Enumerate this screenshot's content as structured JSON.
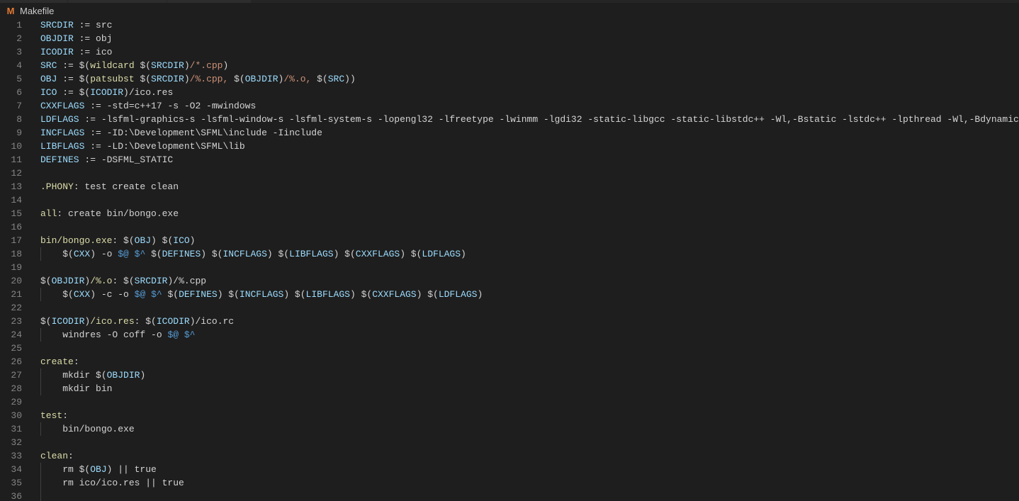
{
  "tab": {
    "icon": "makefile-icon",
    "filename": "Makefile",
    "icon_letter": "M"
  },
  "colors": {
    "background": "#1e1e1e",
    "line_number": "#858585",
    "variable": "#9cdcfe",
    "string": "#ce9178",
    "target": "#dcdcaa",
    "automatic_variable": "#569cd6",
    "default_text": "#d4d4d4",
    "icon_orange": "#e37933"
  },
  "lines": [
    {
      "n": "1",
      "indent": false,
      "tokens": [
        [
          "var",
          "SRCDIR"
        ],
        [
          "def",
          " := src"
        ]
      ]
    },
    {
      "n": "2",
      "indent": false,
      "tokens": [
        [
          "var",
          "OBJDIR"
        ],
        [
          "def",
          " := obj"
        ]
      ]
    },
    {
      "n": "3",
      "indent": false,
      "tokens": [
        [
          "var",
          "ICODIR"
        ],
        [
          "def",
          " := ico"
        ]
      ]
    },
    {
      "n": "4",
      "indent": false,
      "tokens": [
        [
          "var",
          "SRC"
        ],
        [
          "def",
          " := $("
        ],
        [
          "fn",
          "wildcard"
        ],
        [
          "def",
          " $("
        ],
        [
          "var",
          "SRCDIR"
        ],
        [
          "def",
          ")"
        ],
        [
          "str",
          "/*.cpp"
        ],
        [
          "def",
          ")"
        ]
      ]
    },
    {
      "n": "5",
      "indent": false,
      "tokens": [
        [
          "var",
          "OBJ"
        ],
        [
          "def",
          " := $("
        ],
        [
          "fn",
          "patsubst"
        ],
        [
          "def",
          " $("
        ],
        [
          "var",
          "SRCDIR"
        ],
        [
          "def",
          ")"
        ],
        [
          "str",
          "/%.cpp, "
        ],
        [
          "def",
          "$("
        ],
        [
          "var",
          "OBJDIR"
        ],
        [
          "def",
          ")"
        ],
        [
          "str",
          "/%.o, "
        ],
        [
          "def",
          "$("
        ],
        [
          "var",
          "SRC"
        ],
        [
          "def",
          "))"
        ]
      ]
    },
    {
      "n": "6",
      "indent": false,
      "tokens": [
        [
          "var",
          "ICO"
        ],
        [
          "def",
          " := $("
        ],
        [
          "var",
          "ICODIR"
        ],
        [
          "def",
          ")/ico.res"
        ]
      ]
    },
    {
      "n": "7",
      "indent": false,
      "tokens": [
        [
          "var",
          "CXXFLAGS"
        ],
        [
          "def",
          " := -std=c++17 -s -O2 -mwindows"
        ]
      ]
    },
    {
      "n": "8",
      "indent": false,
      "tokens": [
        [
          "var",
          "LDFLAGS"
        ],
        [
          "def",
          " := -lsfml-graphics-s -lsfml-window-s -lsfml-system-s -lopengl32 -lfreetype -lwinmm -lgdi32 -static-libgcc -static-libstdc++ -Wl,-Bstatic -lstdc++ -lpthread -Wl,-Bdynamic"
        ]
      ]
    },
    {
      "n": "9",
      "indent": false,
      "tokens": [
        [
          "var",
          "INCFLAGS"
        ],
        [
          "def",
          " := -ID:\\Development\\SFML\\include -Iinclude"
        ]
      ]
    },
    {
      "n": "10",
      "indent": false,
      "tokens": [
        [
          "var",
          "LIBFLAGS"
        ],
        [
          "def",
          " := -LD:\\Development\\SFML\\lib"
        ]
      ]
    },
    {
      "n": "11",
      "indent": false,
      "tokens": [
        [
          "var",
          "DEFINES"
        ],
        [
          "def",
          " := -DSFML_STATIC"
        ]
      ]
    },
    {
      "n": "12",
      "indent": false,
      "tokens": []
    },
    {
      "n": "13",
      "indent": false,
      "tokens": [
        [
          "tgt",
          ".PHONY"
        ],
        [
          "def",
          ": test create clean"
        ]
      ]
    },
    {
      "n": "14",
      "indent": false,
      "tokens": []
    },
    {
      "n": "15",
      "indent": false,
      "tokens": [
        [
          "tgt",
          "all"
        ],
        [
          "def",
          ": create bin/bongo.exe"
        ]
      ]
    },
    {
      "n": "16",
      "indent": false,
      "tokens": []
    },
    {
      "n": "17",
      "indent": false,
      "tokens": [
        [
          "tgt",
          "bin/bongo.exe"
        ],
        [
          "def",
          ": $("
        ],
        [
          "var",
          "OBJ"
        ],
        [
          "def",
          ") $("
        ],
        [
          "var",
          "ICO"
        ],
        [
          "def",
          ")"
        ]
      ]
    },
    {
      "n": "18",
      "indent": true,
      "tokens": [
        [
          "def",
          "    $("
        ],
        [
          "var",
          "CXX"
        ],
        [
          "def",
          ") -o "
        ],
        [
          "auto",
          "$@"
        ],
        [
          "def",
          " "
        ],
        [
          "auto",
          "$^"
        ],
        [
          "def",
          " $("
        ],
        [
          "var",
          "DEFINES"
        ],
        [
          "def",
          ") $("
        ],
        [
          "var",
          "INCFLAGS"
        ],
        [
          "def",
          ") $("
        ],
        [
          "var",
          "LIBFLAGS"
        ],
        [
          "def",
          ") $("
        ],
        [
          "var",
          "CXXFLAGS"
        ],
        [
          "def",
          ") $("
        ],
        [
          "var",
          "LDFLAGS"
        ],
        [
          "def",
          ")"
        ]
      ]
    },
    {
      "n": "19",
      "indent": false,
      "tokens": []
    },
    {
      "n": "20",
      "indent": false,
      "tokens": [
        [
          "def",
          "$("
        ],
        [
          "var",
          "OBJDIR"
        ],
        [
          "def",
          ")"
        ],
        [
          "tgt",
          "/%.o"
        ],
        [
          "def",
          ": $("
        ],
        [
          "var",
          "SRCDIR"
        ],
        [
          "def",
          ")/%.cpp"
        ]
      ]
    },
    {
      "n": "21",
      "indent": true,
      "tokens": [
        [
          "def",
          "    $("
        ],
        [
          "var",
          "CXX"
        ],
        [
          "def",
          ") -c -o "
        ],
        [
          "auto",
          "$@"
        ],
        [
          "def",
          " "
        ],
        [
          "auto",
          "$^"
        ],
        [
          "def",
          " $("
        ],
        [
          "var",
          "DEFINES"
        ],
        [
          "def",
          ") $("
        ],
        [
          "var",
          "INCFLAGS"
        ],
        [
          "def",
          ") $("
        ],
        [
          "var",
          "LIBFLAGS"
        ],
        [
          "def",
          ") $("
        ],
        [
          "var",
          "CXXFLAGS"
        ],
        [
          "def",
          ") $("
        ],
        [
          "var",
          "LDFLAGS"
        ],
        [
          "def",
          ")"
        ]
      ]
    },
    {
      "n": "22",
      "indent": false,
      "tokens": []
    },
    {
      "n": "23",
      "indent": false,
      "tokens": [
        [
          "def",
          "$("
        ],
        [
          "var",
          "ICODIR"
        ],
        [
          "def",
          ")"
        ],
        [
          "tgt",
          "/ico.res"
        ],
        [
          "def",
          ": $("
        ],
        [
          "var",
          "ICODIR"
        ],
        [
          "def",
          ")/ico.rc"
        ]
      ]
    },
    {
      "n": "24",
      "indent": true,
      "tokens": [
        [
          "def",
          "    windres -O coff -o "
        ],
        [
          "auto",
          "$@"
        ],
        [
          "def",
          " "
        ],
        [
          "auto",
          "$^"
        ]
      ]
    },
    {
      "n": "25",
      "indent": false,
      "tokens": []
    },
    {
      "n": "26",
      "indent": false,
      "tokens": [
        [
          "tgt",
          "create"
        ],
        [
          "def",
          ":"
        ]
      ]
    },
    {
      "n": "27",
      "indent": true,
      "tokens": [
        [
          "def",
          "    mkdir $("
        ],
        [
          "var",
          "OBJDIR"
        ],
        [
          "def",
          ")"
        ]
      ]
    },
    {
      "n": "28",
      "indent": true,
      "tokens": [
        [
          "def",
          "    mkdir bin"
        ]
      ]
    },
    {
      "n": "29",
      "indent": false,
      "tokens": []
    },
    {
      "n": "30",
      "indent": false,
      "tokens": [
        [
          "tgt",
          "test"
        ],
        [
          "def",
          ":"
        ]
      ]
    },
    {
      "n": "31",
      "indent": true,
      "tokens": [
        [
          "def",
          "    bin/bongo.exe"
        ]
      ]
    },
    {
      "n": "32",
      "indent": false,
      "tokens": []
    },
    {
      "n": "33",
      "indent": false,
      "tokens": [
        [
          "tgt",
          "clean"
        ],
        [
          "def",
          ":"
        ]
      ]
    },
    {
      "n": "34",
      "indent": true,
      "tokens": [
        [
          "def",
          "    rm $("
        ],
        [
          "var",
          "OBJ"
        ],
        [
          "def",
          ") || true"
        ]
      ]
    },
    {
      "n": "35",
      "indent": true,
      "tokens": [
        [
          "def",
          "    rm ico/ico.res || true"
        ]
      ]
    },
    {
      "n": "36",
      "indent": true,
      "tokens": []
    }
  ]
}
